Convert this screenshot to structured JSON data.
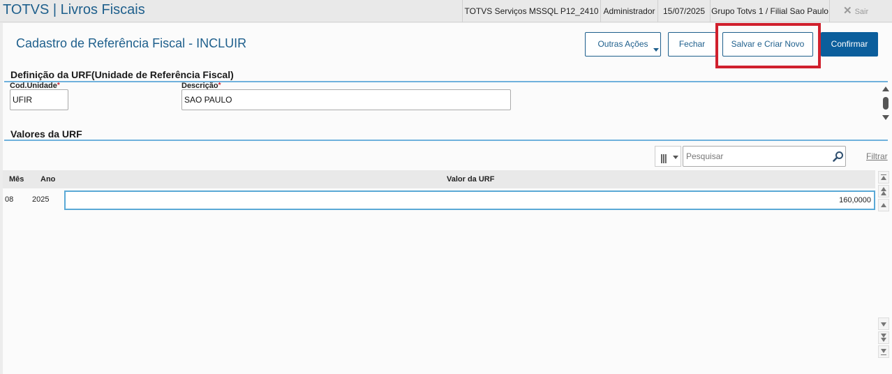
{
  "header": {
    "app_title": "TOTVS | Livros Fiscais",
    "environment": "TOTVS Serviços MSSQL P12_2410",
    "user": "Administrador",
    "date": "15/07/2025",
    "branch": "Grupo Totvs 1 / Filial Sao Paulo",
    "exit_label": "Sair"
  },
  "page": {
    "title": "Cadastro de Referência Fiscal - INCLUIR"
  },
  "toolbar": {
    "outras_acoes": "Outras Ações",
    "fechar": "Fechar",
    "salvar_criar_novo": "Salvar e Criar Novo",
    "confirmar": "Confirmar"
  },
  "section_definicao": {
    "title": "Definição da URF(Unidade de Referência Fiscal)",
    "cod_unidade_label": "Cod.Unidade",
    "cod_unidade_value": "UFIR",
    "descricao_label": "Descrição",
    "descricao_value": "SAO PAULO",
    "required_mark": "*"
  },
  "section_valores": {
    "title": "Valores da URF",
    "search_placeholder": "Pesquisar",
    "filter_label": "Filtrar",
    "columns": [
      "Mês",
      "Ano",
      "Valor da URF"
    ],
    "rows": [
      {
        "mes": "08",
        "ano": "2025",
        "valor": "160,0000"
      }
    ]
  },
  "colors": {
    "brand": "#1e5f8c",
    "primary_button": "#0b5e9c",
    "highlight": "#d0202d",
    "section_line": "#6fb1dc"
  },
  "icons": {
    "exit": "close-icon",
    "search": "magnifier-icon",
    "columns": "columns-icon"
  }
}
